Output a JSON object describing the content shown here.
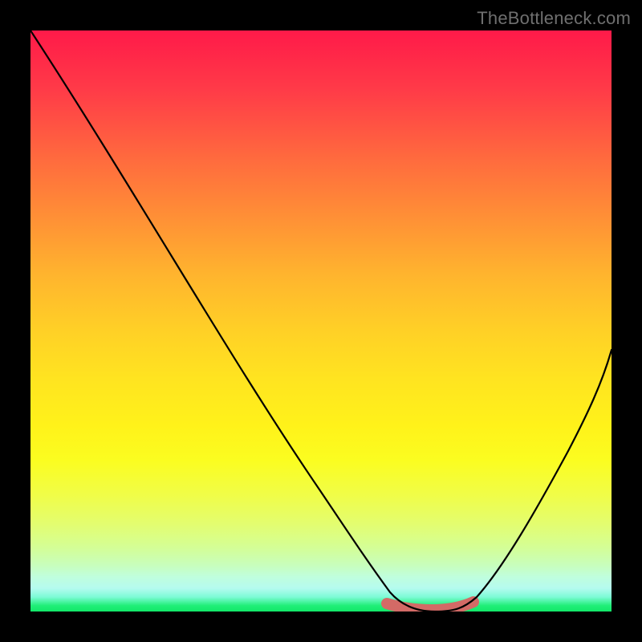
{
  "watermark": "TheBottleneck.com",
  "chart_data": {
    "type": "line",
    "title": "",
    "xlabel": "",
    "ylabel": "",
    "xlim": [
      0,
      100
    ],
    "ylim": [
      0,
      100
    ],
    "series": [
      {
        "name": "bottleneck-curve",
        "x": [
          0,
          12,
          24,
          36,
          48,
          56,
          60,
          63,
          66,
          70,
          74,
          76,
          82,
          90,
          100
        ],
        "values": [
          100,
          84,
          67,
          50,
          33,
          19,
          10,
          4,
          1,
          0,
          0,
          1,
          8,
          22,
          45
        ]
      }
    ],
    "highlight": {
      "name": "optimal-range",
      "x_start": 62,
      "x_end": 76,
      "color": "#d36a66",
      "thickness": 14
    },
    "gradient_stops": [
      {
        "pos": 0,
        "color": "#ff1a49"
      },
      {
        "pos": 50,
        "color": "#ffd126"
      },
      {
        "pos": 75,
        "color": "#fbfd20"
      },
      {
        "pos": 100,
        "color": "#12e869"
      }
    ]
  }
}
